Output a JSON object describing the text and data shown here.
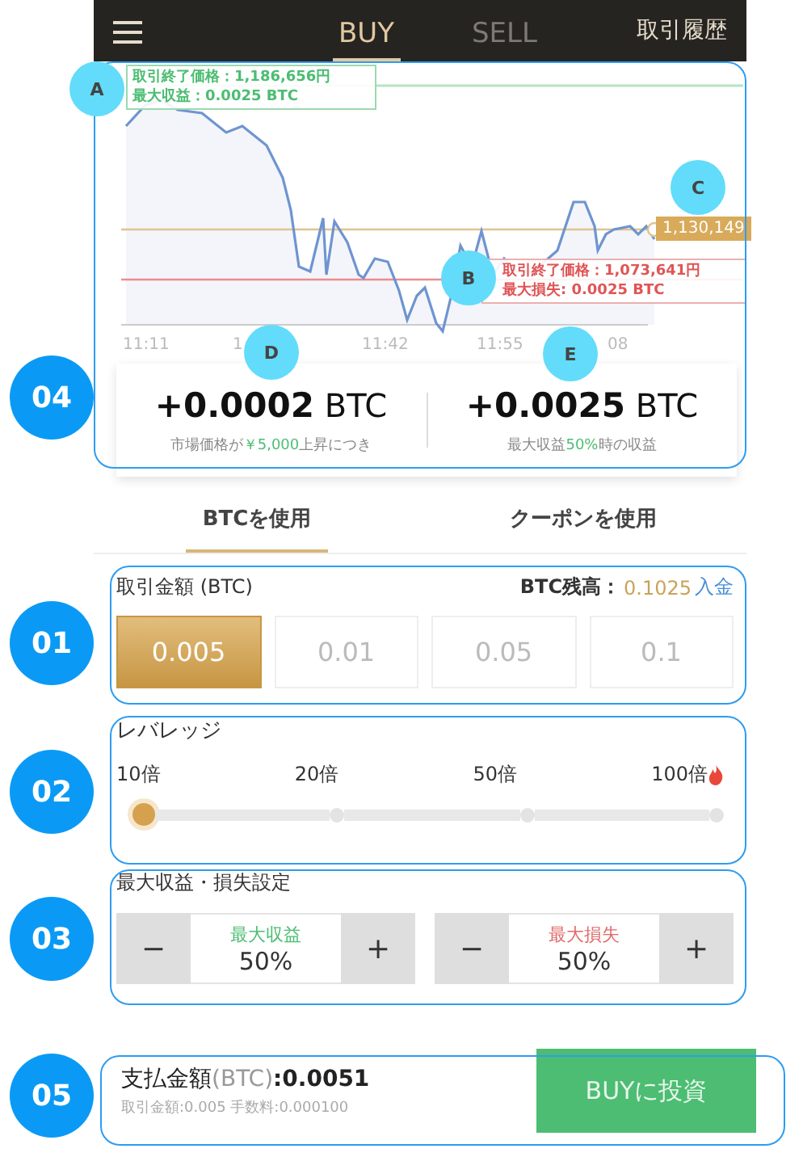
{
  "nav": {
    "tabs": [
      {
        "label": "BUY",
        "selected": true
      },
      {
        "label": "SELL",
        "selected": false
      }
    ],
    "history": "取引履歴"
  },
  "chart": {
    "take_profit": [
      "取引終了価格：1,186,656円",
      "最大収益：0.0025 BTC"
    ],
    "stop_loss": [
      "取引終了価格：1,073,641円",
      "最大損失: 0.0025 BTC"
    ],
    "current_price": "1,130,149",
    "time_labels": [
      "11:11",
      "1",
      "11:42",
      "11:55",
      "08"
    ]
  },
  "summary": [
    {
      "value": "+0.0002",
      "unit": "BTC",
      "note": [
        {
          "text": "市場価格が",
          "highlight": false
        },
        {
          "text": "￥5,000",
          "highlight": true
        },
        {
          "text": "上昇につき",
          "highlight": false
        }
      ]
    },
    {
      "value": "+0.0025",
      "unit": "BTC",
      "note": [
        {
          "text": "最大収益",
          "highlight": false
        },
        {
          "text": "50%",
          "highlight": true
        },
        {
          "text": "時の収益",
          "highlight": false
        }
      ]
    }
  ],
  "pay_tabs": [
    {
      "label": "BTCを使用",
      "selected": true
    },
    {
      "label": "クーポンを使用",
      "selected": false
    }
  ],
  "amount": {
    "label": "取引金額 (BTC)",
    "balance_label": "BTC残高：",
    "balance": "0.1025",
    "deposit": "入金",
    "options": [
      {
        "label": "0.005",
        "selected": true
      },
      {
        "label": "0.01",
        "selected": false
      },
      {
        "label": "0.05",
        "selected": false
      },
      {
        "label": "0.1",
        "selected": false
      }
    ]
  },
  "leverage": {
    "title": "レバレッジ",
    "options": [
      {
        "label": "10倍",
        "selected": true,
        "hot": false
      },
      {
        "label": "20倍",
        "selected": false,
        "hot": false
      },
      {
        "label": "50倍",
        "selected": false,
        "hot": false
      },
      {
        "label": "100倍",
        "selected": false,
        "hot": true
      }
    ]
  },
  "limits": {
    "title": "最大収益・損失設定",
    "controls": [
      {
        "kind": "profit",
        "minus": "−",
        "label": "最大収益",
        "value": "50%",
        "plus": "+"
      },
      {
        "kind": "loss",
        "minus": "−",
        "label": "最大損失",
        "value": "50%",
        "plus": "+"
      }
    ]
  },
  "footer": {
    "total_label": "支払金額",
    "total_unit": "(BTC)",
    "total_value": ":0.0051",
    "detail": "取引金額:0.005 手数料:0.000100",
    "button": "BUYに投資"
  },
  "annotations": {
    "letters": [
      "A",
      "B",
      "C",
      "D",
      "E"
    ],
    "sections": [
      "04",
      "01",
      "02",
      "03",
      "05"
    ]
  }
}
